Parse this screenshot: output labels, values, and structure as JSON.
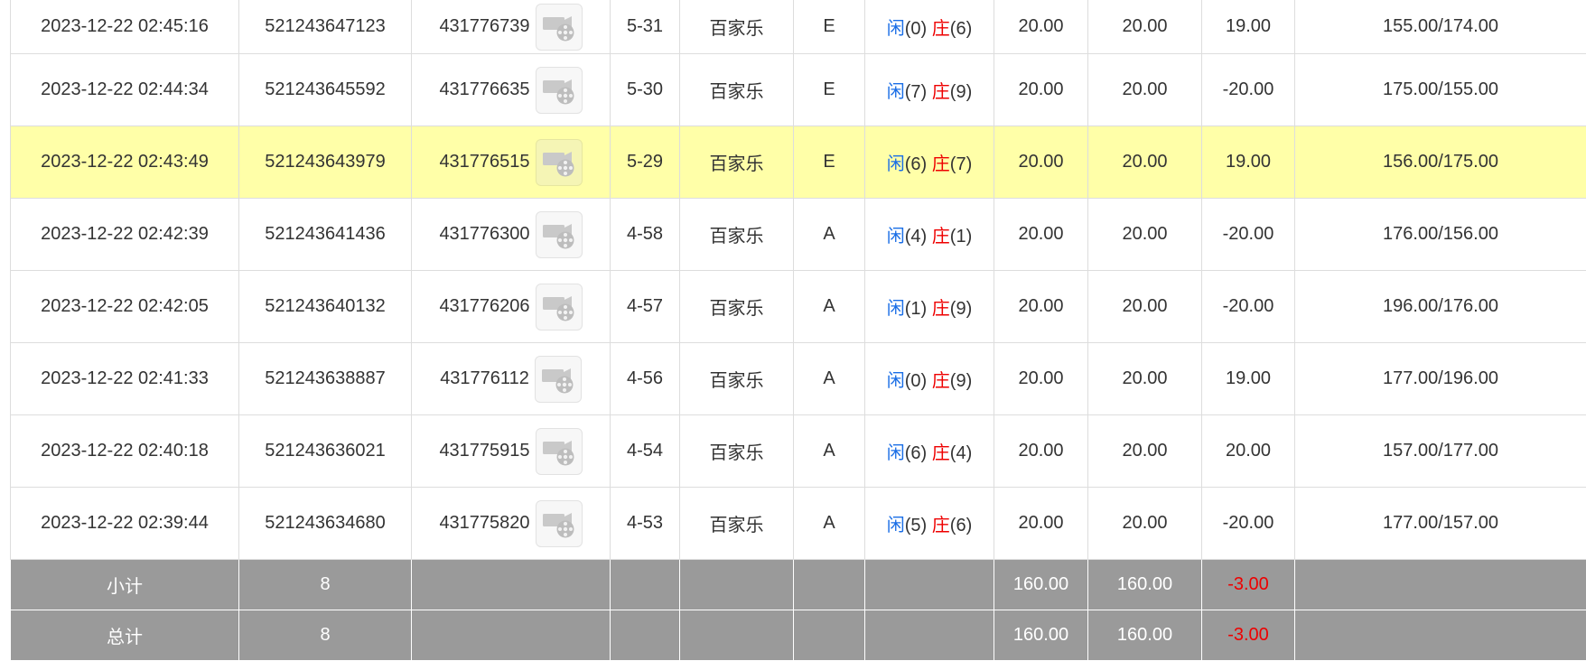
{
  "rows": [
    {
      "time": "2023-12-22 02:45:16",
      "bet_id": "521243647123",
      "round_id": "431776739",
      "shoe": "5-31",
      "game": "百家乐",
      "table": "E",
      "player_label": "闲",
      "player_score": "(0)",
      "banker_label": "庄",
      "banker_score": "(6)",
      "bet": "20.00",
      "valid_bet": "20.00",
      "win_loss": "19.00",
      "balance": "155.00/174.00",
      "highlight": false
    },
    {
      "time": "2023-12-22 02:44:34",
      "bet_id": "521243645592",
      "round_id": "431776635",
      "shoe": "5-30",
      "game": "百家乐",
      "table": "E",
      "player_label": "闲",
      "player_score": "(7)",
      "banker_label": "庄",
      "banker_score": "(9)",
      "bet": "20.00",
      "valid_bet": "20.00",
      "win_loss": "-20.00",
      "balance": "175.00/155.00",
      "highlight": false
    },
    {
      "time": "2023-12-22 02:43:49",
      "bet_id": "521243643979",
      "round_id": "431776515",
      "shoe": "5-29",
      "game": "百家乐",
      "table": "E",
      "player_label": "闲",
      "player_score": "(6)",
      "banker_label": "庄",
      "banker_score": "(7)",
      "bet": "20.00",
      "valid_bet": "20.00",
      "win_loss": "19.00",
      "balance": "156.00/175.00",
      "highlight": true
    },
    {
      "time": "2023-12-22 02:42:39",
      "bet_id": "521243641436",
      "round_id": "431776300",
      "shoe": "4-58",
      "game": "百家乐",
      "table": "A",
      "player_label": "闲",
      "player_score": "(4)",
      "banker_label": "庄",
      "banker_score": "(1)",
      "bet": "20.00",
      "valid_bet": "20.00",
      "win_loss": "-20.00",
      "balance": "176.00/156.00",
      "highlight": false
    },
    {
      "time": "2023-12-22 02:42:05",
      "bet_id": "521243640132",
      "round_id": "431776206",
      "shoe": "4-57",
      "game": "百家乐",
      "table": "A",
      "player_label": "闲",
      "player_score": "(1)",
      "banker_label": "庄",
      "banker_score": "(9)",
      "bet": "20.00",
      "valid_bet": "20.00",
      "win_loss": "-20.00",
      "balance": "196.00/176.00",
      "highlight": false
    },
    {
      "time": "2023-12-22 02:41:33",
      "bet_id": "521243638887",
      "round_id": "431776112",
      "shoe": "4-56",
      "game": "百家乐",
      "table": "A",
      "player_label": "闲",
      "player_score": "(0)",
      "banker_label": "庄",
      "banker_score": "(9)",
      "bet": "20.00",
      "valid_bet": "20.00",
      "win_loss": "19.00",
      "balance": "177.00/196.00",
      "highlight": false
    },
    {
      "time": "2023-12-22 02:40:18",
      "bet_id": "521243636021",
      "round_id": "431775915",
      "shoe": "4-54",
      "game": "百家乐",
      "table": "A",
      "player_label": "闲",
      "player_score": "(6)",
      "banker_label": "庄",
      "banker_score": "(4)",
      "bet": "20.00",
      "valid_bet": "20.00",
      "win_loss": "20.00",
      "balance": "157.00/177.00",
      "highlight": false
    },
    {
      "time": "2023-12-22 02:39:44",
      "bet_id": "521243634680",
      "round_id": "431775820",
      "shoe": "4-53",
      "game": "百家乐",
      "table": "A",
      "player_label": "闲",
      "player_score": "(5)",
      "banker_label": "庄",
      "banker_score": "(6)",
      "bet": "20.00",
      "valid_bet": "20.00",
      "win_loss": "-20.00",
      "balance": "177.00/157.00",
      "highlight": false
    }
  ],
  "subtotal": {
    "label": "小计",
    "count": "8",
    "bet": "160.00",
    "valid_bet": "160.00",
    "win_loss": "-3.00"
  },
  "total": {
    "label": "总计",
    "count": "8",
    "bet": "160.00",
    "valid_bet": "160.00",
    "win_loss": "-3.00"
  },
  "icons": {
    "replay": "video-replay-icon"
  },
  "colors": {
    "player": "#1a6ee6",
    "banker": "#ee0000",
    "loss": "#ee0000",
    "highlight": "#ffffa8",
    "summary_bg": "#9a9a9a"
  }
}
